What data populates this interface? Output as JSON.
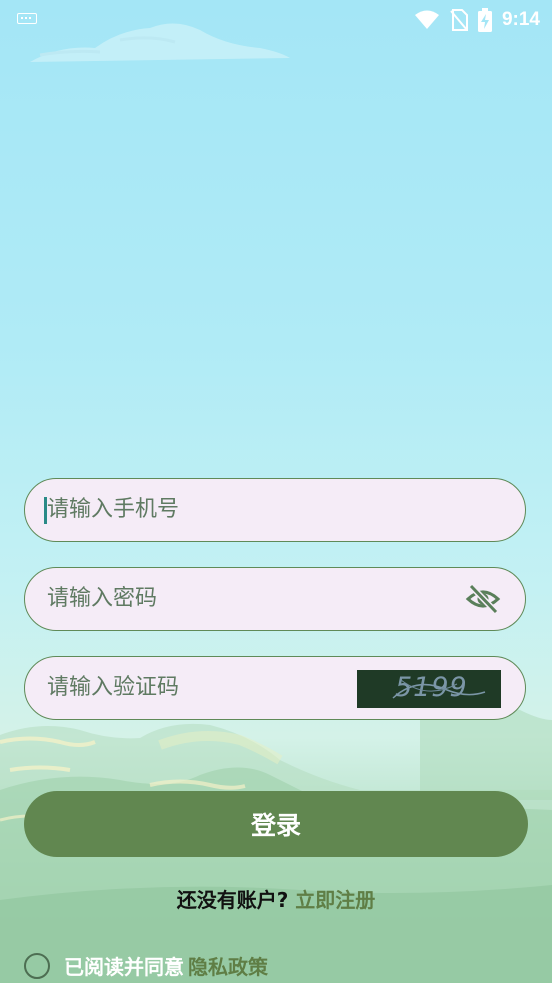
{
  "status_bar": {
    "time": "9:14",
    "icons": [
      "keyboard-icon",
      "wifi-icon",
      "no-sim-icon",
      "battery-charging-icon"
    ]
  },
  "form": {
    "phone_placeholder": "请输入手机号",
    "password_placeholder": "请输入密码",
    "captcha_placeholder": "请输入验证码",
    "captcha_text": "5199",
    "password_toggle_icon": "eye-off-icon"
  },
  "login_label": "登录",
  "register": {
    "prompt": "还没有账户?",
    "link": "立即注册"
  },
  "agreement": {
    "text": "已阅读并同意",
    "link": "隐私政策"
  },
  "colors": {
    "accent": "#618750",
    "link": "#5f7e45",
    "field_bg": "#f5ecf7",
    "field_border": "#5f8a58"
  }
}
